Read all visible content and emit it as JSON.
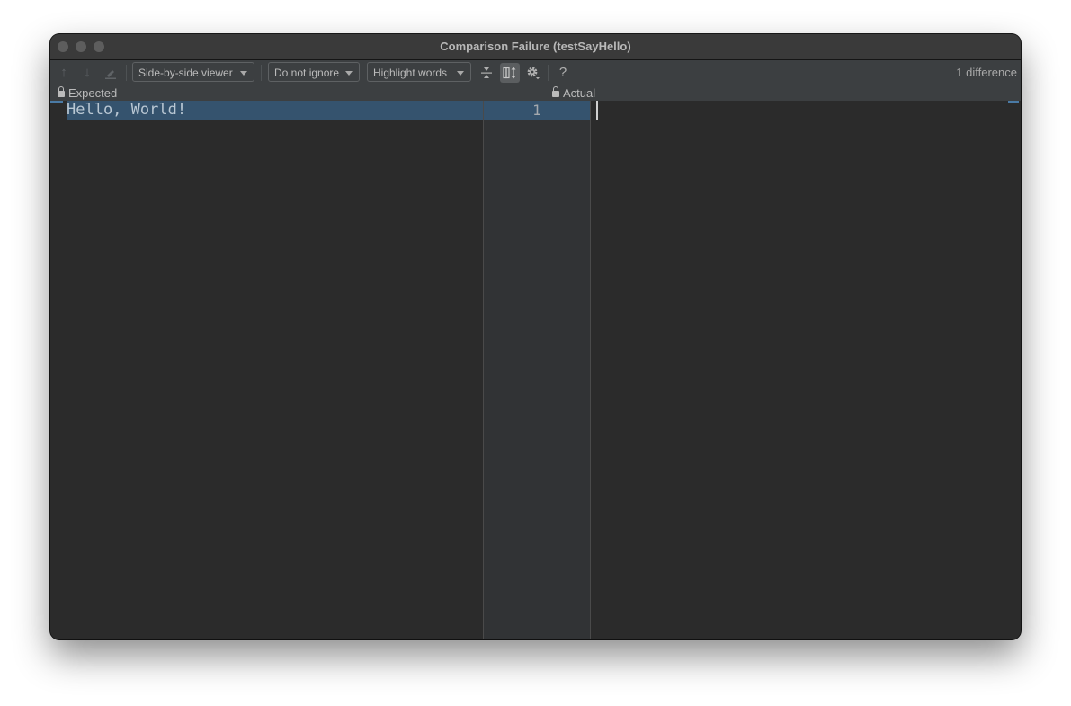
{
  "window": {
    "title": "Comparison Failure (testSayHello)"
  },
  "toolbar": {
    "prev_difference_icon": "arrow-up-icon",
    "next_difference_icon": "arrow-down-icon",
    "edit_icon": "pencil-icon",
    "viewer_dropdown": "Side-by-side viewer",
    "ignore_dropdown": "Do not ignore",
    "highlight_dropdown": "Highlight words",
    "collapse_icon": "collapse-unchanged-icon",
    "sync_scroll_icon": "sync-scroll-icon",
    "settings_icon": "gear-icon",
    "help_label": "?",
    "difference_count": "1 difference"
  },
  "panes": {
    "left": {
      "label": "Expected",
      "locked": true,
      "lines": [
        "Hello, World!"
      ]
    },
    "right": {
      "label": "Actual",
      "locked": true,
      "lines": [
        ""
      ]
    }
  },
  "gutter": {
    "line_numbers": [
      "1"
    ]
  },
  "colors": {
    "diff_highlight": "#35536e",
    "editor_bg": "#2b2b2b",
    "toolbar_bg": "#3c3f41",
    "gutter_bg": "#313335"
  }
}
